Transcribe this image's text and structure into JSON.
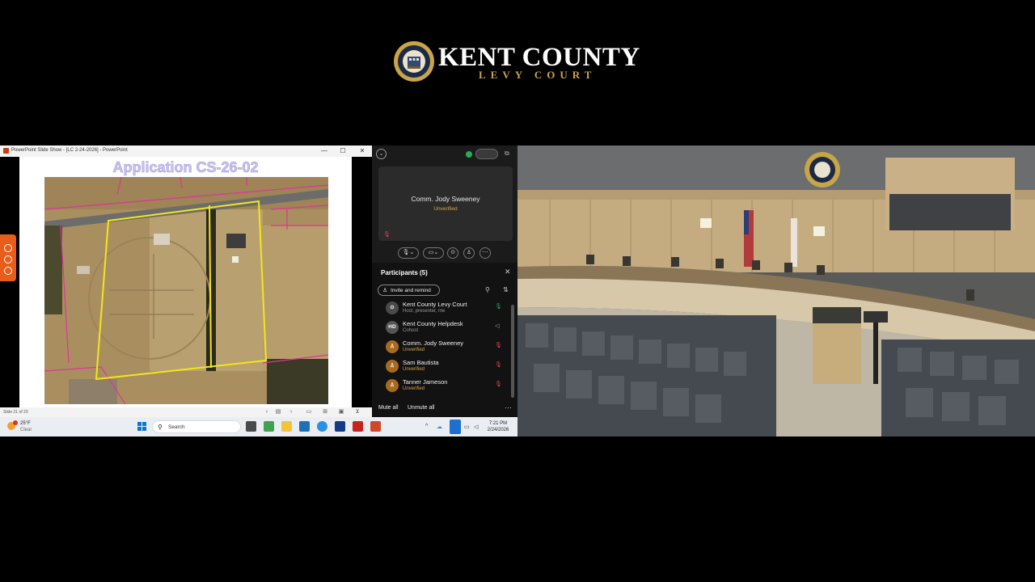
{
  "logo": {
    "title": "KENT COUNTY",
    "subtitle": "LEVY COURT"
  },
  "ppt": {
    "window_title": "PowerPoint Slide Show - [LC 2-24-2026] - PowerPoint",
    "window_controls": [
      "—",
      "☐",
      "✕"
    ],
    "slide_title": "Application CS-26-02",
    "slide_counter": "Slide 21 of 23"
  },
  "taskbar": {
    "weather_temp": "25°F",
    "weather_desc": "Clear",
    "search_label": "Search",
    "time": "7:21 PM",
    "date": "2/24/2026"
  },
  "webex": {
    "video_tile": {
      "name": "Comm. Jody Sweeney",
      "status": "Unverified"
    },
    "participants_title": "Participants (5)",
    "invite_label": "Invite and remind",
    "participants": [
      {
        "name": "Kent County Levy Court",
        "role": "Host, presenter, me",
        "avatar": "",
        "avatar_color": "#4a4a4a",
        "role_status": "normal",
        "mic": "on"
      },
      {
        "name": "Kent County Helpdesk",
        "role": "Cohost",
        "avatar": "HD",
        "avatar_color": "#555555",
        "role_status": "normal",
        "mic": "speaker"
      },
      {
        "name": "Comm. Jody Sweeney",
        "role": "Unverified",
        "avatar": "",
        "avatar_color": "#a86a1f",
        "role_status": "unverified",
        "mic": "muted"
      },
      {
        "name": "Sam Bautista",
        "role": "Unverified",
        "avatar": "",
        "avatar_color": "#a86a1f",
        "role_status": "unverified",
        "mic": "muted"
      },
      {
        "name": "Tanner Jameson",
        "role": "Unverified",
        "avatar": "",
        "avatar_color": "#a86a1f",
        "role_status": "unverified",
        "mic": "muted"
      }
    ],
    "mute_all": "Mute all",
    "unmute_all": "Unmute all"
  },
  "colors": {
    "gold": "#c9a449",
    "parcel_outline": "#f2e61b",
    "property_lines": "#e0339a",
    "unverified": "#d9a54a",
    "muted": "#e5484d",
    "webex_green": "#2bab5a"
  },
  "icons": {
    "seal": "county-seal-icon",
    "start": "windows-start-icon",
    "search": "search-icon",
    "mic": "microphone-icon",
    "close": "close-icon"
  }
}
